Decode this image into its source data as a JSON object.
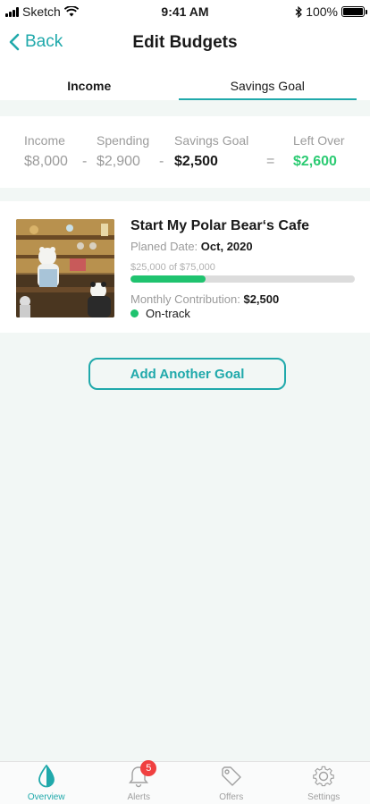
{
  "status_bar": {
    "carrier": "Sketch",
    "time": "9:41 AM",
    "battery": "100%"
  },
  "nav": {
    "back_label": "Back",
    "title": "Edit Budgets"
  },
  "tabs": [
    {
      "label": "Income"
    },
    {
      "label": "Savings Goal"
    }
  ],
  "summary": {
    "income_label": "Income",
    "income_value": "$8,000",
    "spending_label": "Spending",
    "spending_value": "$2,900",
    "savings_label": "Savings Goal",
    "savings_value": "$2,500",
    "leftover_label": "Left Over",
    "leftover_value": "$2,600",
    "minus1": "-",
    "minus2": "-",
    "equals": "="
  },
  "goal": {
    "title": "Start My Polar Bear‘s Cafe",
    "date_label": "Planed Date:",
    "date_value": "Oct, 2020",
    "amount_text": "$25,000 of $75,000",
    "progress": 0.333,
    "contrib_label": "Monthly Contribution:",
    "contrib_value": "$2,500",
    "status": "On-track",
    "image_icon": "polar-bear-cafe-image"
  },
  "add_button": "Add Another Goal",
  "tabbar": [
    {
      "label": "Overview",
      "icon": "drop-icon"
    },
    {
      "label": "Alerts",
      "icon": "bell-icon",
      "badge": "5"
    },
    {
      "label": "Offers",
      "icon": "tag-icon"
    },
    {
      "label": "Settings",
      "icon": "gear-icon"
    }
  ],
  "colors": {
    "accent": "#20a9ab",
    "success": "#2ccb73",
    "badge": "#f04040"
  }
}
